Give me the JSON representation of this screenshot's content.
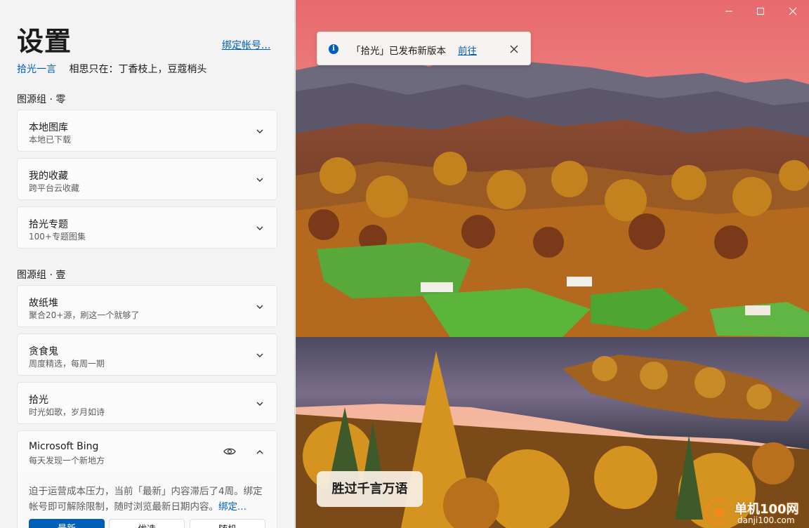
{
  "header": {
    "title": "设置",
    "bind_account_link": "绑定帐号...",
    "quote_source": "拾光一言",
    "quote_text": "相思只在：丁香枝上，豆蔻梢头"
  },
  "groups": [
    {
      "label": "图源组 · 零",
      "items": [
        {
          "title": "本地图库",
          "subtitle": "本地已下载"
        },
        {
          "title": "我的收藏",
          "subtitle": "跨平台云收藏"
        },
        {
          "title": "拾光专题",
          "subtitle": "100+专题图集"
        }
      ]
    },
    {
      "label": "图源组 · 壹",
      "items": [
        {
          "title": "故纸堆",
          "subtitle": "聚合20+源，刷这一个就够了"
        },
        {
          "title": "贪食鬼",
          "subtitle": "周度精选，每周一期"
        },
        {
          "title": "拾光",
          "subtitle": "时光如歌，岁月如诗"
        },
        {
          "title": "Microsoft Bing",
          "subtitle": "每天发现一个新地方"
        }
      ]
    }
  ],
  "expanded": {
    "notice": "迫于运营成本压力，当前「最新」内容滞后了4周。绑定帐号即可解除限制，随时浏览最新日期内容。",
    "notice_link": "绑定...",
    "buttons": [
      "最新",
      "优选",
      "随机"
    ]
  },
  "toast": {
    "message": "「拾光」已发布新版本",
    "action": "前往"
  },
  "caption": "胜过千言万语",
  "watermark": {
    "name": "单机100网",
    "url": "danji100.com"
  },
  "colors": {
    "accent": "#005fb8",
    "panel_bg": "#f3f3f3",
    "card_bg": "#fbfbfb"
  },
  "icons": {
    "card_collapsed": "chevron-down-icon",
    "card_expanded": "chevron-up-icon",
    "preview": "eye-icon",
    "toast_info": "info-icon",
    "toast_close": "close-icon"
  }
}
